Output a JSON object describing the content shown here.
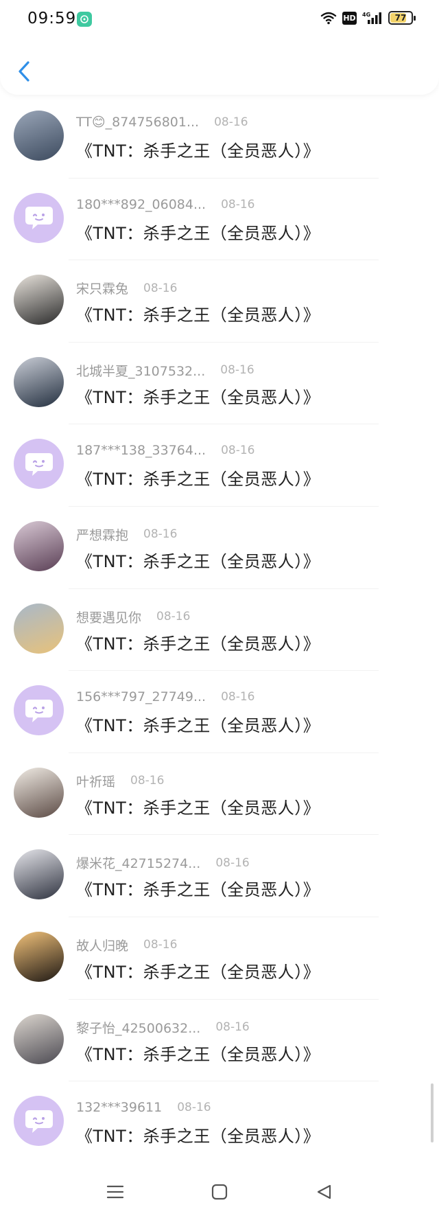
{
  "status_bar": {
    "time": "09:59",
    "hd": "HD",
    "network": "4G",
    "battery_percent": "77",
    "battery_level": 0.77
  },
  "header": {
    "back_icon": "chevron-left-icon",
    "accent_color": "#2f8fe8"
  },
  "comments": [
    {
      "name": "TT😊_874756801...",
      "date": "08-16",
      "text": "《TNT：杀手之王（全员恶人）》",
      "avatar": "photo"
    },
    {
      "name": "180***892_06084...",
      "date": "08-16",
      "text": "《TNT：杀手之王（全员恶人）》",
      "avatar": "default"
    },
    {
      "name": "宋只霖兔",
      "date": "08-16",
      "text": "《TNT：杀手之王（全员恶人）》",
      "avatar": "photo"
    },
    {
      "name": "北城半夏_3107532...",
      "date": "08-16",
      "text": "《TNT：杀手之王（全员恶人）》",
      "avatar": "photo"
    },
    {
      "name": "187***138_33764...",
      "date": "08-16",
      "text": "《TNT：杀手之王（全员恶人）》",
      "avatar": "default"
    },
    {
      "name": "严想霖抱",
      "date": "08-16",
      "text": "《TNT：杀手之王（全员恶人）》",
      "avatar": "photo"
    },
    {
      "name": "想要遇见你",
      "date": "08-16",
      "text": "《TNT：杀手之王（全员恶人）》",
      "avatar": "photo"
    },
    {
      "name": "156***797_27749...",
      "date": "08-16",
      "text": "《TNT：杀手之王（全员恶人）》",
      "avatar": "default"
    },
    {
      "name": "叶祈瑶",
      "date": "08-16",
      "text": "《TNT：杀手之王（全员恶人）》",
      "avatar": "photo"
    },
    {
      "name": "爆米花_42715274...",
      "date": "08-16",
      "text": "《TNT：杀手之王（全员恶人）》",
      "avatar": "photo"
    },
    {
      "name": "故人归晚",
      "date": "08-16",
      "text": "《TNT：杀手之王（全员恶人）》",
      "avatar": "photo"
    },
    {
      "name": "黎子怡_42500632...",
      "date": "08-16",
      "text": "《TNT：杀手之王（全员恶人）》",
      "avatar": "photo"
    },
    {
      "name": "132***39611",
      "date": "08-16",
      "text": "《TNT：杀手之王（全员恶人）》",
      "avatar": "default"
    }
  ],
  "nav_bar": {
    "menu_icon": "menu-icon",
    "home_icon": "home-square-icon",
    "back_icon": "back-triangle-icon"
  }
}
